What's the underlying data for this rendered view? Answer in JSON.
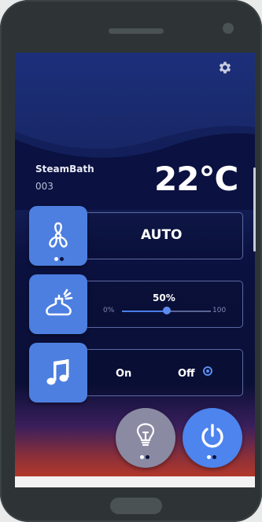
{
  "device": {
    "title": "SteamBath",
    "subtitle": "003"
  },
  "temperature": "22°C",
  "fan": {
    "mode_label": "AUTO"
  },
  "steam": {
    "value_label": "50%",
    "min_label": "0%",
    "max_label": "100",
    "level_percent": 50
  },
  "music": {
    "on_label": "On",
    "off_label": "Off",
    "selected": "Off"
  },
  "colors": {
    "accent": "#4d7fe0",
    "background_top": "#1c2f7a",
    "background_bottom": "#b3382a"
  },
  "icons": {
    "settings": "gear-icon",
    "fan": "fan-icon",
    "steam": "steam-icon",
    "music": "music-note-icon",
    "light": "light-bulb-icon",
    "power": "power-icon"
  }
}
